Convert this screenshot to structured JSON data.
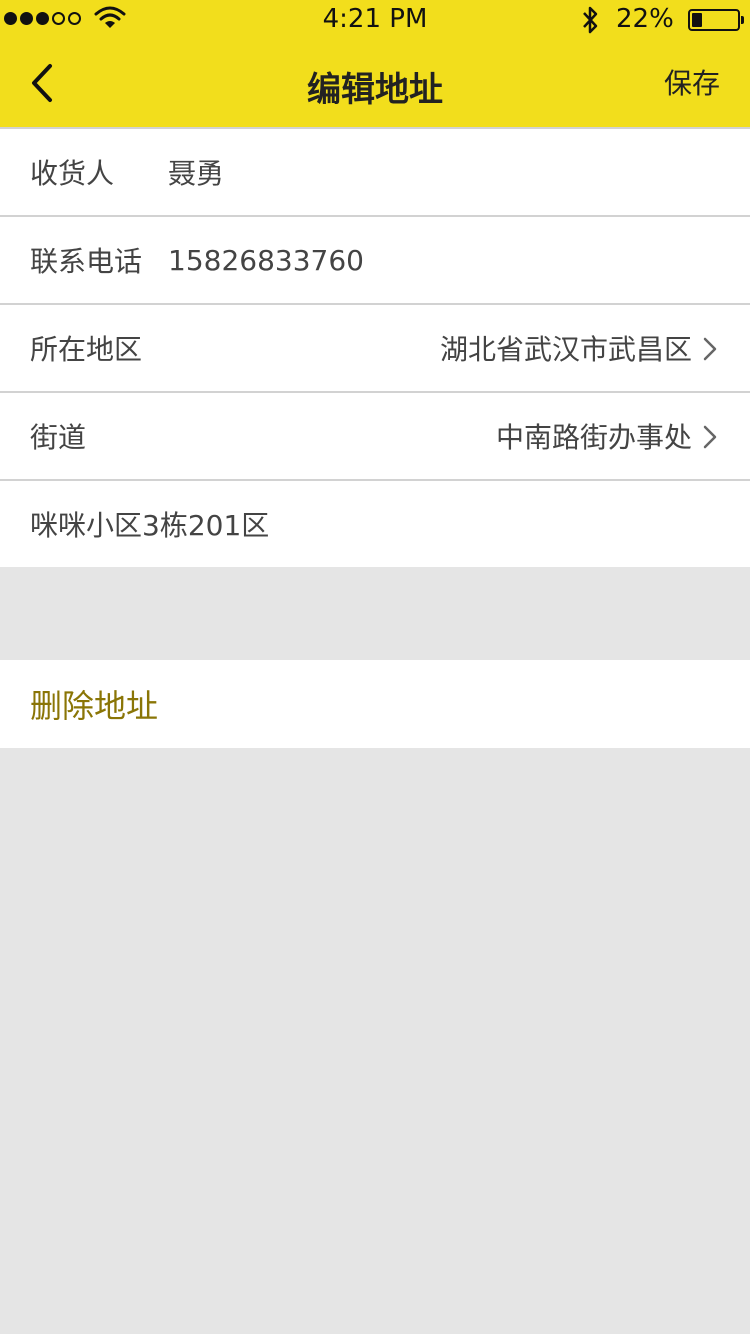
{
  "status_bar": {
    "time": "4:21 PM",
    "battery_text": "22%",
    "battery_level": 0.22,
    "signal_bars_filled": 3,
    "signal_bars_total": 5,
    "icons": [
      "signal-icon",
      "wifi-icon",
      "bluetooth-icon",
      "battery-icon"
    ]
  },
  "nav": {
    "title": "编辑地址",
    "save_label": "保存",
    "back_icon": "chevron-left-icon"
  },
  "form": {
    "recipient": {
      "label": "收货人",
      "value": "聂勇"
    },
    "phone": {
      "label": "联系电话",
      "value": "15826833760"
    },
    "region": {
      "label": "所在地区",
      "value": "湖北省武汉市武昌区"
    },
    "street": {
      "label": "街道",
      "value": "中南路街办事处"
    },
    "detail": {
      "value": "咪咪小区3栋201区"
    }
  },
  "delete": {
    "label": "删除地址",
    "color": "#8a7506"
  },
  "colors": {
    "header": "#f2de1c",
    "background": "#e5e5e5",
    "divider": "#d2d2d2"
  }
}
